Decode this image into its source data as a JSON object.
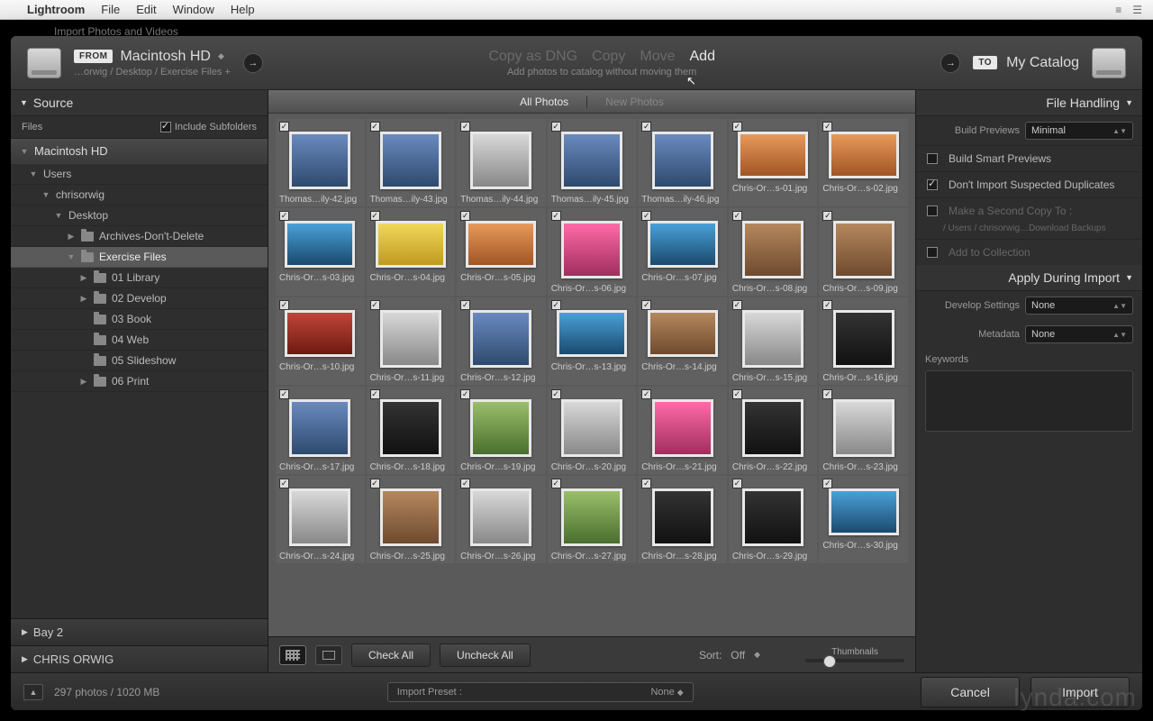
{
  "menubar": {
    "app": "Lightroom",
    "items": [
      "File",
      "Edit",
      "Window",
      "Help"
    ]
  },
  "dialog_title": "Import Photos and Videos",
  "from": {
    "badge": "FROM",
    "drive": "Macintosh HD",
    "path": "…orwig / Desktop / Exercise Files +"
  },
  "to": {
    "badge": "TO",
    "catalog": "My Catalog"
  },
  "modes": {
    "items": [
      "Copy as DNG",
      "Copy",
      "Move",
      "Add"
    ],
    "active": 3,
    "desc": "Add photos to catalog without moving them"
  },
  "source": {
    "title": "Source",
    "files_label": "Files",
    "include_subfolders": "Include Subfolders",
    "tree": [
      {
        "label": "Macintosh HD",
        "type": "hd",
        "expand": "down"
      },
      {
        "label": "Users",
        "indent": 1,
        "expand": "down"
      },
      {
        "label": "chrisorwig",
        "indent": 2,
        "expand": "down"
      },
      {
        "label": "Desktop",
        "indent": 3,
        "expand": "down"
      },
      {
        "label": "Archives-Don't-Delete",
        "indent": 4,
        "expand": "right",
        "folder": true
      },
      {
        "label": "Exercise Files",
        "indent": 4,
        "expand": "down",
        "folder": true,
        "selected": true
      },
      {
        "label": "01 Library",
        "indent": 5,
        "expand": "right",
        "folder": true
      },
      {
        "label": "02 Develop",
        "indent": 5,
        "expand": "right",
        "folder": true
      },
      {
        "label": "03 Book",
        "indent": 5,
        "folder": true
      },
      {
        "label": "04 Web",
        "indent": 5,
        "folder": true
      },
      {
        "label": "05 Slideshow",
        "indent": 5,
        "folder": true
      },
      {
        "label": "06 Print",
        "indent": 5,
        "expand": "right",
        "folder": true
      }
    ],
    "collapsed": [
      "Bay 2",
      "CHRIS ORWIG"
    ]
  },
  "tabs": {
    "items": [
      "All Photos",
      "New Photos"
    ],
    "active": 0
  },
  "thumbs": [
    {
      "fn": "Thomas…ily-42.jpg",
      "g": 0
    },
    {
      "fn": "Thomas…ily-43.jpg",
      "g": 0
    },
    {
      "fn": "Thomas…ily-44.jpg",
      "g": 5
    },
    {
      "fn": "Thomas…ily-45.jpg",
      "g": 0
    },
    {
      "fn": "Thomas…ily-46.jpg",
      "g": 0
    },
    {
      "fn": "Chris-Or…s-01.jpg",
      "g": 2,
      "w": 1
    },
    {
      "fn": "Chris-Or…s-02.jpg",
      "g": 2,
      "w": 1
    },
    {
      "fn": "Chris-Or…s-03.jpg",
      "g": 7,
      "w": 1
    },
    {
      "fn": "Chris-Or…s-04.jpg",
      "g": 8,
      "w": 1
    },
    {
      "fn": "Chris-Or…s-05.jpg",
      "g": 2,
      "w": 1
    },
    {
      "fn": "Chris-Or…s-06.jpg",
      "g": 6
    },
    {
      "fn": "Chris-Or…s-07.jpg",
      "g": 7,
      "w": 1
    },
    {
      "fn": "Chris-Or…s-08.jpg",
      "g": 1
    },
    {
      "fn": "Chris-Or…s-09.jpg",
      "g": 1
    },
    {
      "fn": "Chris-Or…s-10.jpg",
      "g": 9,
      "w": 1
    },
    {
      "fn": "Chris-Or…s-11.jpg",
      "g": 5
    },
    {
      "fn": "Chris-Or…s-12.jpg",
      "g": 0
    },
    {
      "fn": "Chris-Or…s-13.jpg",
      "g": 7,
      "w": 1
    },
    {
      "fn": "Chris-Or…s-14.jpg",
      "g": 1,
      "w": 1
    },
    {
      "fn": "Chris-Or…s-15.jpg",
      "g": 5
    },
    {
      "fn": "Chris-Or…s-16.jpg",
      "g": 3
    },
    {
      "fn": "Chris-Or…s-17.jpg",
      "g": 0
    },
    {
      "fn": "Chris-Or…s-18.jpg",
      "g": 3
    },
    {
      "fn": "Chris-Or…s-19.jpg",
      "g": 4
    },
    {
      "fn": "Chris-Or…s-20.jpg",
      "g": 5
    },
    {
      "fn": "Chris-Or…s-21.jpg",
      "g": 6
    },
    {
      "fn": "Chris-Or…s-22.jpg",
      "g": 3
    },
    {
      "fn": "Chris-Or…s-23.jpg",
      "g": 5
    },
    {
      "fn": "Chris-Or…s-24.jpg",
      "g": 5
    },
    {
      "fn": "Chris-Or…s-25.jpg",
      "g": 1
    },
    {
      "fn": "Chris-Or…s-26.jpg",
      "g": 5
    },
    {
      "fn": "Chris-Or…s-27.jpg",
      "g": 4
    },
    {
      "fn": "Chris-Or…s-28.jpg",
      "g": 3
    },
    {
      "fn": "Chris-Or…s-29.jpg",
      "g": 3
    },
    {
      "fn": "Chris-Or…s-30.jpg",
      "g": 7,
      "w": 1
    }
  ],
  "centerbar": {
    "check_all": "Check All",
    "uncheck_all": "Uncheck All",
    "sort_label": "Sort:",
    "sort_value": "Off",
    "thumb_label": "Thumbnails"
  },
  "right": {
    "file_handling": "File Handling",
    "build_previews_label": "Build Previews",
    "build_previews_value": "Minimal",
    "smart_previews": "Build Smart Previews",
    "no_dup": "Don't Import Suspected Duplicates",
    "second_copy": "Make a Second Copy To :",
    "second_copy_path": "/ Users / chrisorwig…Download Backups",
    "add_collection": "Add to Collection",
    "apply_during": "Apply During Import",
    "develop_label": "Develop Settings",
    "develop_value": "None",
    "metadata_label": "Metadata",
    "metadata_value": "None",
    "keywords_label": "Keywords"
  },
  "footer": {
    "status": "297 photos / 1020 MB",
    "preset_label": "Import Preset :",
    "preset_value": "None",
    "cancel": "Cancel",
    "import": "Import"
  },
  "watermark": "lynda.com"
}
